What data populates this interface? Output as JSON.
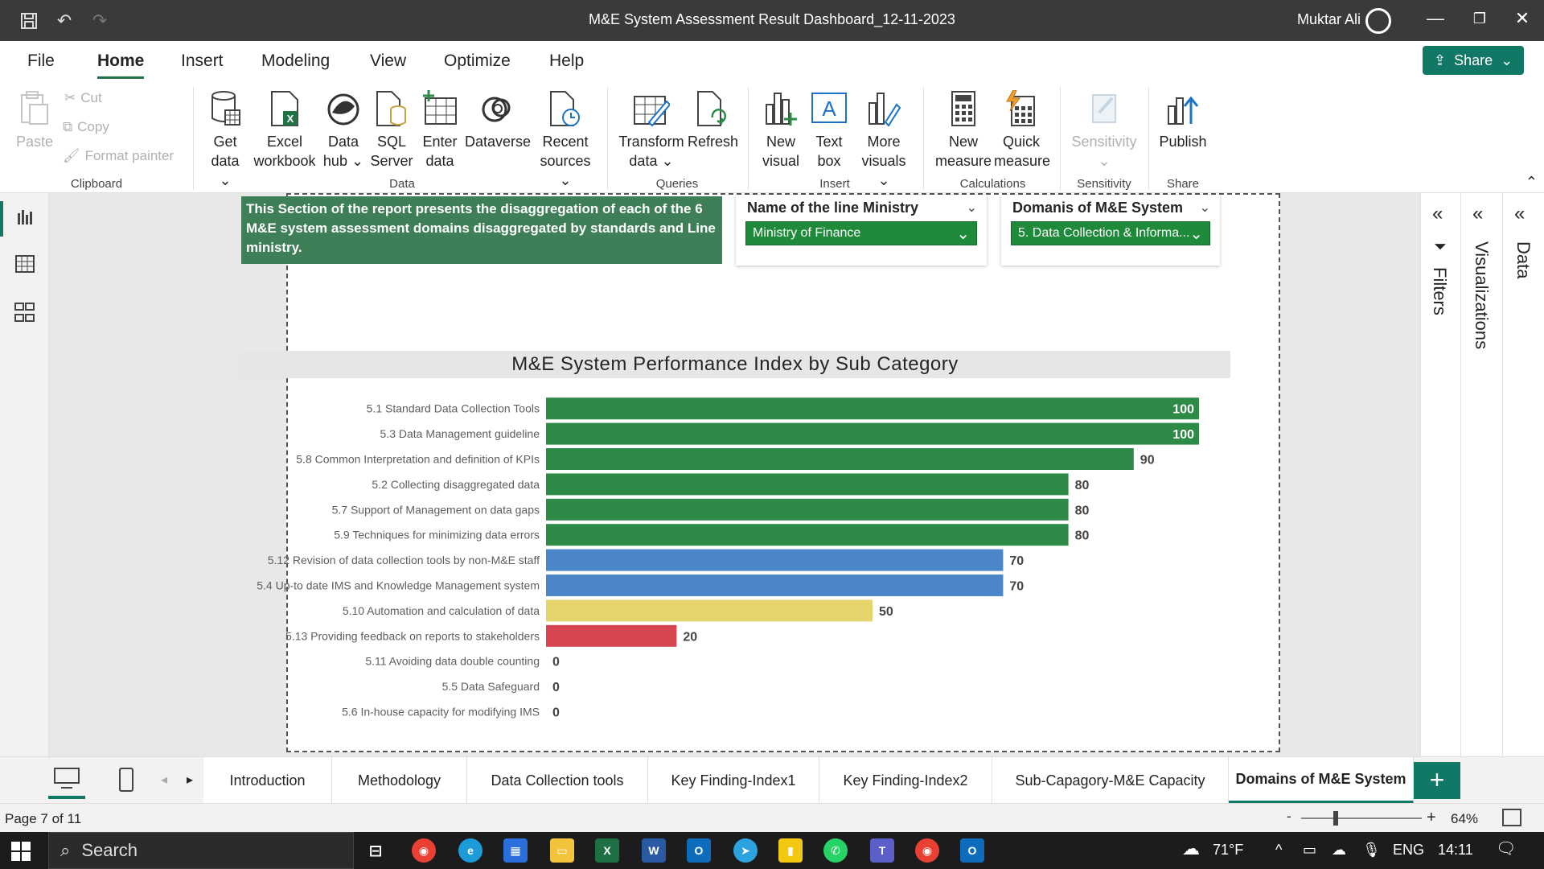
{
  "window": {
    "title": "M&E System Assessment Result Dashboard_12-11-2023",
    "user": "Muktar Ali"
  },
  "menu": {
    "tabs": [
      "File",
      "Home",
      "Insert",
      "Modeling",
      "View",
      "Optimize",
      "Help"
    ],
    "active": "Home",
    "share_label": "Share"
  },
  "ribbon": {
    "clipboard": {
      "paste": "Paste",
      "cut": "Cut",
      "copy": "Copy",
      "format_painter": "Format painter",
      "label": "Clipboard"
    },
    "data": {
      "get_data": [
        "Get",
        "data"
      ],
      "excel": [
        "Excel",
        "workbook"
      ],
      "data_hub": [
        "Data",
        "hub"
      ],
      "sql": [
        "SQL",
        "Server"
      ],
      "enter": [
        "Enter",
        "data"
      ],
      "dataverse": "Dataverse",
      "recent": [
        "Recent",
        "sources"
      ],
      "label": "Data"
    },
    "queries": {
      "transform": [
        "Transform",
        "data"
      ],
      "refresh": "Refresh",
      "label": "Queries"
    },
    "insert": {
      "new_visual": [
        "New",
        "visual"
      ],
      "text_box": [
        "Text",
        "box"
      ],
      "more_visuals": [
        "More",
        "visuals"
      ],
      "label": "Insert"
    },
    "calculations": {
      "new_measure": [
        "New",
        "measure"
      ],
      "quick_measure": [
        "Quick",
        "measure"
      ],
      "label": "Calculations"
    },
    "sensitivity": {
      "button": "Sensitivity",
      "label": "Sensitivity"
    },
    "share": {
      "publish": "Publish",
      "label": "Share"
    }
  },
  "report": {
    "info_text": "This Section of the report presents the disaggregation of each of the 6 M&E system assessment domains disaggregated by standards and Line ministry.",
    "slicer_ministry": {
      "title": "Name of the line Ministry",
      "value": "Ministry of Finance"
    },
    "slicer_domain": {
      "title": "Domanis of M&E System",
      "value": "5. Data Collection & Informa..."
    },
    "chart_title": "M&E System Performance Index by Sub Category"
  },
  "chart_data": {
    "type": "bar",
    "orientation": "horizontal",
    "title": "M&E System Performance Index by Sub Category",
    "categories": [
      "5.1 Standard Data Collection Tools",
      "5.3 Data Management guideline",
      "5.8 Common Interpretation and definition of KPIs",
      "5.2 Collecting disaggregated data",
      "5.7 Support of Management on data gaps",
      "5.9 Techniques for minimizing data errors",
      "5.12 Revision of data collection tools by non-M&E staff",
      "5.4 Up-to date IMS and Knowledge Management system",
      "5.10 Automation and calculation of data",
      "5.13 Providing feedback on reports to stakeholders",
      "5.11 Avoiding data double counting",
      "5.5 Data Safeguard",
      "5.6 In-house capacity for modifying IMS"
    ],
    "values": [
      100,
      100,
      90,
      80,
      80,
      80,
      70,
      70,
      50,
      20,
      0,
      0,
      0
    ],
    "bar_colors": [
      "#2e8b47",
      "#2e8b47",
      "#2e8b47",
      "#2e8b47",
      "#2e8b47",
      "#2e8b47",
      "#4a86c8",
      "#4a86c8",
      "#e5d36b",
      "#d64550",
      "#2e8b47",
      "#2e8b47",
      "#2e8b47"
    ],
    "xlim": [
      0,
      100
    ],
    "grid": false,
    "legend": "none"
  },
  "panes": {
    "filters": "Filters",
    "visualizations": "Visualizations",
    "data": "Data"
  },
  "page_tabs": {
    "tabs": [
      "Introduction",
      "Methodology",
      "Data Collection tools",
      "Key Finding-Index1",
      "Key Finding-Index2",
      "Sub-Capagory-M&E Capacity",
      "Domains of M&E System"
    ],
    "active_index": 6
  },
  "status": {
    "page": "Page 7 of 11",
    "zoom": "64%"
  },
  "taskbar": {
    "search": "Search",
    "weather": "71°F",
    "lang": "ENG",
    "time": "14:11"
  },
  "colors": {
    "accent": "#117865",
    "title_bg": "#3b3a39",
    "info_box": "#3f7f57",
    "slicer_fill": "#1f8a3a"
  }
}
